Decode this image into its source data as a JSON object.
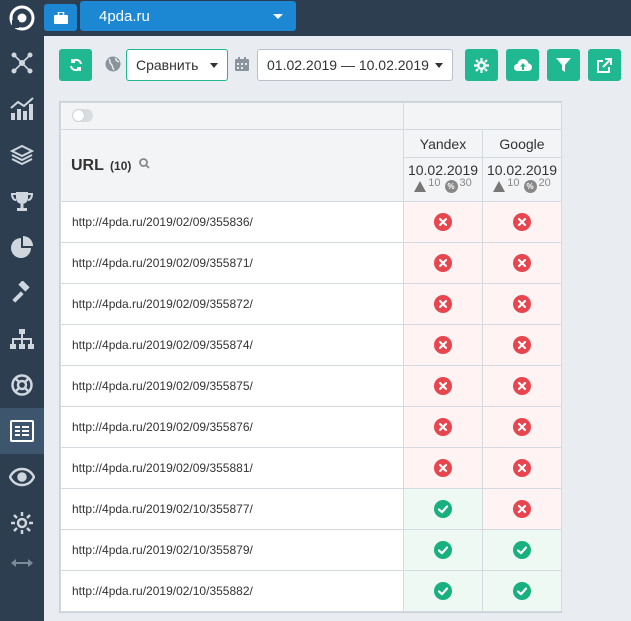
{
  "topbar": {
    "site_label": "4pda.ru"
  },
  "toolbar": {
    "compare_label": "Сравнить",
    "date_range": "01.02.2019 — 10.02.2019"
  },
  "table": {
    "url_header": "URL",
    "url_count": "(10)",
    "engines": [
      {
        "name": "Yandex",
        "date": "10.02.2019",
        "warn_count": "10",
        "pct_count": "30"
      },
      {
        "name": "Google",
        "date": "10.02.2019",
        "warn_count": "10",
        "pct_count": "20"
      }
    ],
    "rows": [
      {
        "url": "http://4pda.ru/2019/02/09/355836/",
        "yandex": "bad",
        "google": "bad"
      },
      {
        "url": "http://4pda.ru/2019/02/09/355871/",
        "yandex": "bad",
        "google": "bad"
      },
      {
        "url": "http://4pda.ru/2019/02/09/355872/",
        "yandex": "bad",
        "google": "bad"
      },
      {
        "url": "http://4pda.ru/2019/02/09/355874/",
        "yandex": "bad",
        "google": "bad"
      },
      {
        "url": "http://4pda.ru/2019/02/09/355875/",
        "yandex": "bad",
        "google": "bad"
      },
      {
        "url": "http://4pda.ru/2019/02/09/355876/",
        "yandex": "bad",
        "google": "bad"
      },
      {
        "url": "http://4pda.ru/2019/02/09/355881/",
        "yandex": "bad",
        "google": "bad"
      },
      {
        "url": "http://4pda.ru/2019/02/10/355877/",
        "yandex": "good",
        "google": "bad"
      },
      {
        "url": "http://4pda.ru/2019/02/10/355879/",
        "yandex": "good",
        "google": "good"
      },
      {
        "url": "http://4pda.ru/2019/02/10/355882/",
        "yandex": "good",
        "google": "good"
      }
    ]
  },
  "colors": {
    "sidebar": "#2c3e50",
    "accent_blue": "#1c87d2",
    "accent_green": "#1fb890",
    "bad": "#e8464f",
    "good": "#18b07e"
  }
}
